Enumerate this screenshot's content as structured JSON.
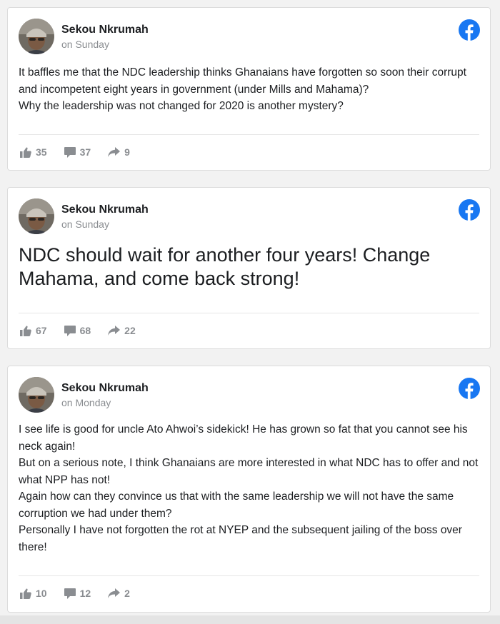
{
  "colors": {
    "facebook_blue": "#1877f2",
    "meta_gray": "#8a8d91",
    "text": "#1c1e21"
  },
  "posts": [
    {
      "author": "Sekou Nkrumah",
      "time": "on Sunday",
      "paragraphs": [
        "It baffles me that the NDC leadership thinks Ghanaians have forgotten so soon their corrupt and incompetent eight years in government (under Mills and Mahama)?",
        "Why the leadership was not changed for 2020 is another mystery?"
      ],
      "likes": "35",
      "comments": "37",
      "shares": "9",
      "source_icon": "facebook-icon"
    },
    {
      "author": "Sekou Nkrumah",
      "time": "on Sunday",
      "paragraphs": [
        "NDC should wait for another four years! Change Mahama, and come back strong!"
      ],
      "likes": "67",
      "comments": "68",
      "shares": "22",
      "source_icon": "facebook-icon"
    },
    {
      "author": "Sekou Nkrumah",
      "time": "on Monday",
      "paragraphs": [
        "I see life is good for uncle Ato Ahwoi’s sidekick! He has grown so fat that you cannot see his neck again!",
        "But on a serious note, I think Ghanaians are more interested in what NDC has to offer and not what NPP has not!",
        "Again how can they convince us that with the same leadership we will not have the same corruption we had under them?",
        "Personally I have not forgotten the rot at NYEP and the subsequent jailing of the boss over there!"
      ],
      "likes": "10",
      "comments": "12",
      "shares": "2",
      "source_icon": "facebook-icon"
    }
  ]
}
